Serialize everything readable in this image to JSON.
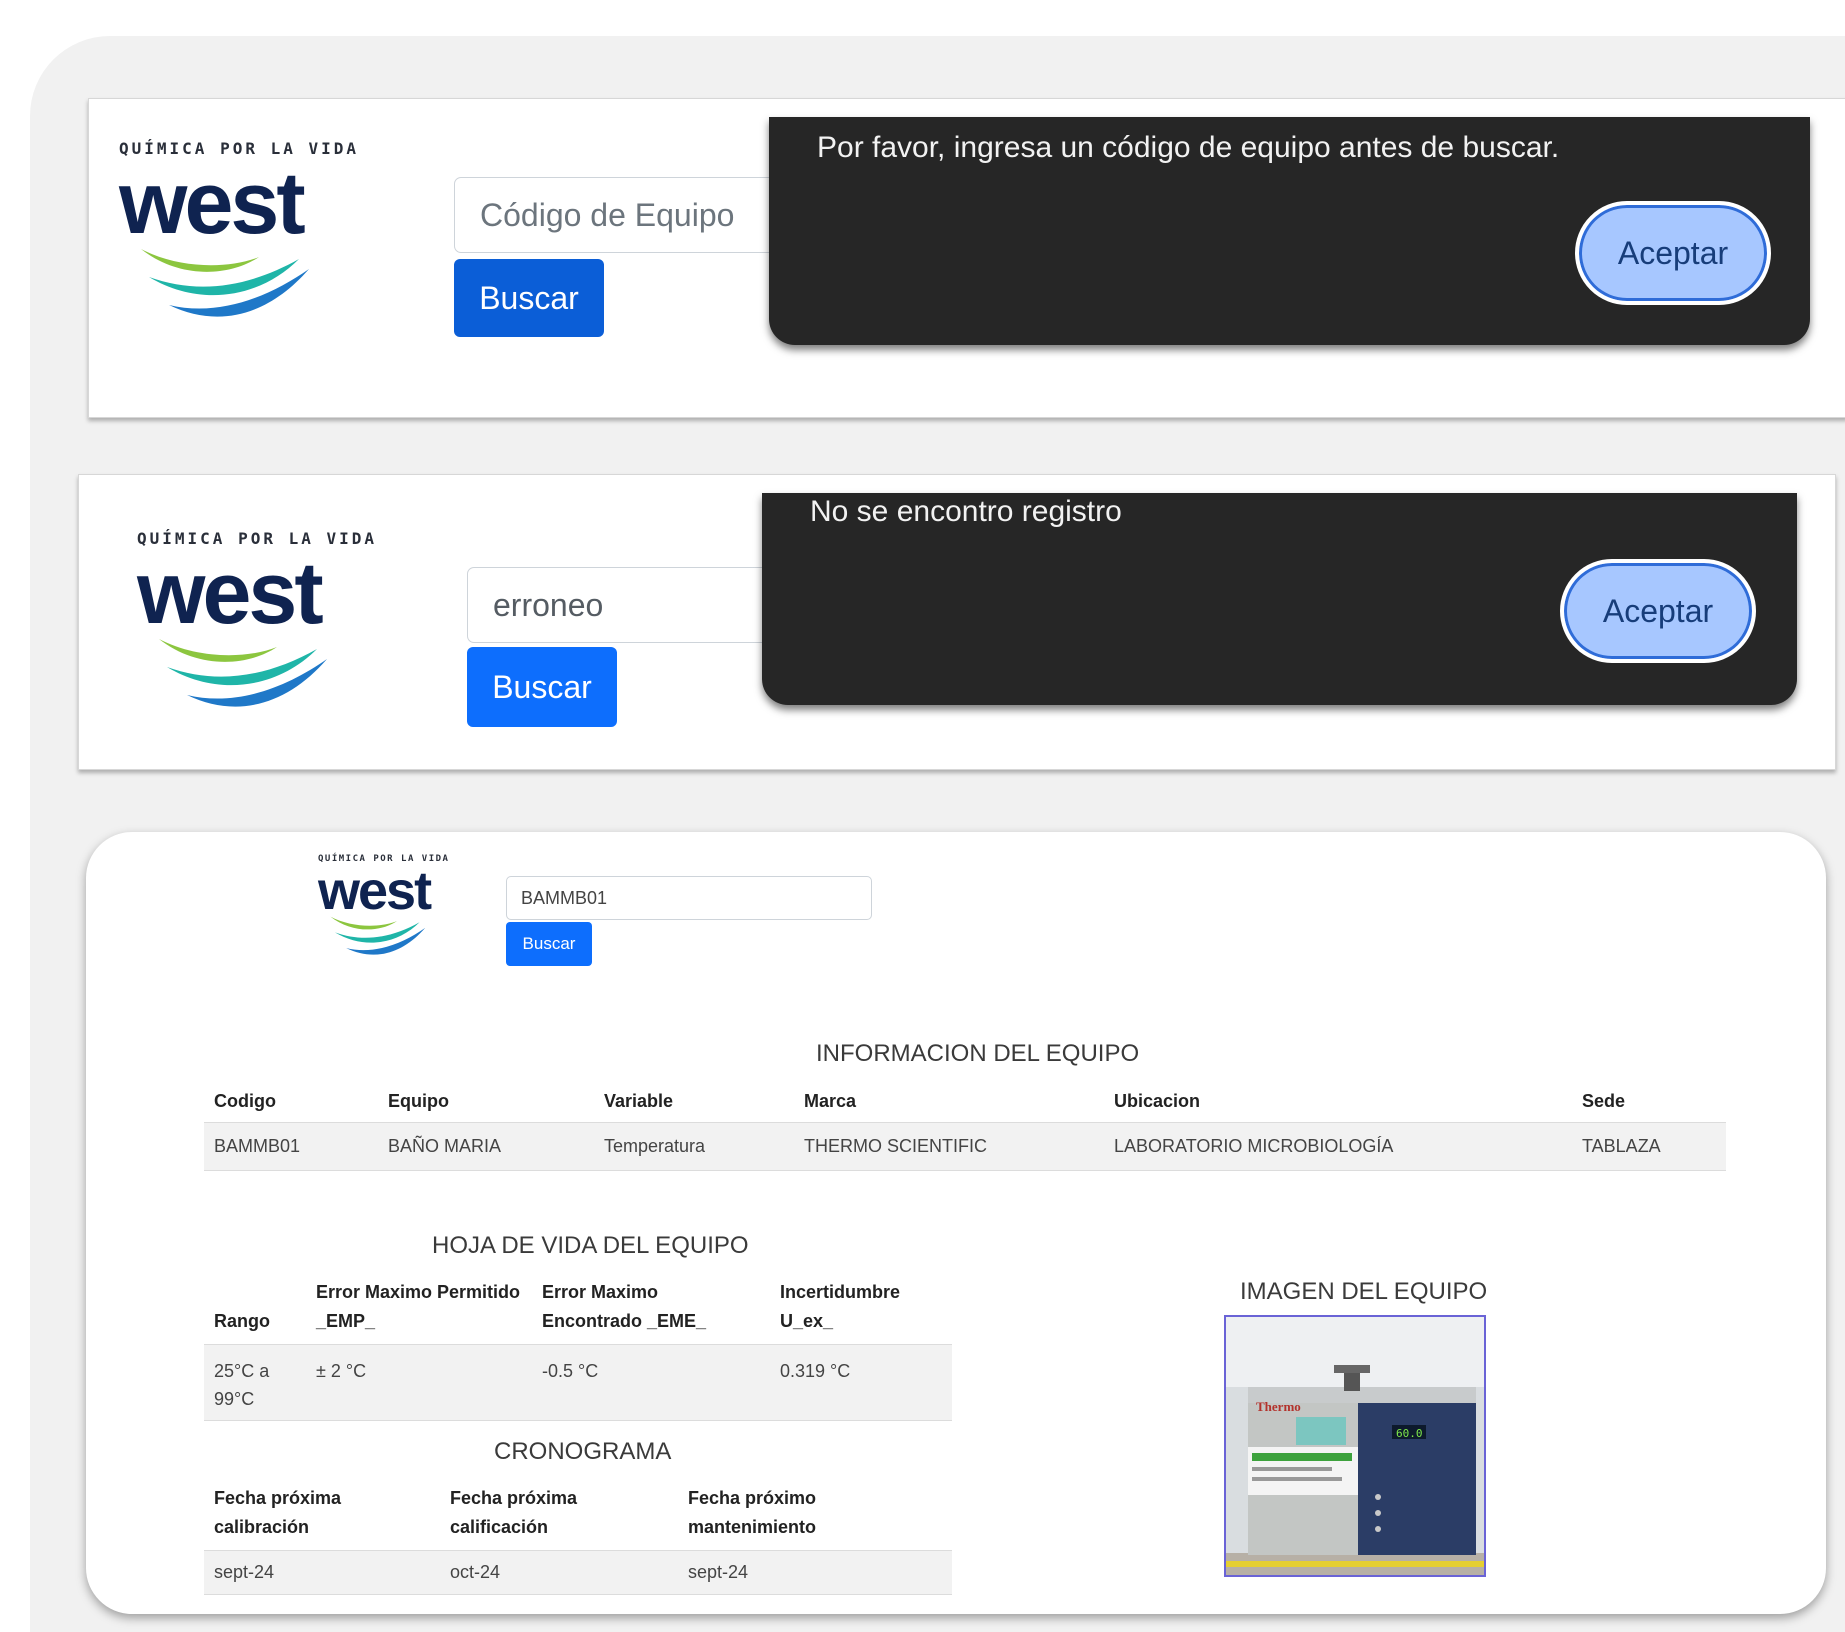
{
  "logo": {
    "tagline": "QUÍMICA POR LA VIDA",
    "wordmark": "west"
  },
  "panel1": {
    "search": {
      "placeholder": "Código de Equipo",
      "button": "Buscar"
    },
    "dialog": {
      "message": "Por favor, ingresa un código de equipo antes de buscar.",
      "button": "Aceptar"
    }
  },
  "panel2": {
    "search": {
      "value": "erroneo",
      "button": "Buscar"
    },
    "dialog": {
      "message": "No se encontro registro",
      "button": "Aceptar"
    }
  },
  "panel3": {
    "search": {
      "value": "BAMMB01",
      "button": "Buscar"
    },
    "info": {
      "title": "INFORMACION DEL EQUIPO",
      "headers": [
        "Codigo",
        "Equipo",
        "Variable",
        "Marca",
        "Ubicacion",
        "Sede"
      ],
      "row": [
        "BAMMB01",
        "BAÑO MARIA",
        "Temperatura",
        "THERMO SCIENTIFIC",
        "LABORATORIO MICROBIOLOGÍA",
        "TABLAZA"
      ]
    },
    "hoja": {
      "title": "HOJA DE VIDA DEL EQUIPO",
      "headers": [
        "Rango",
        "Error Maximo Permitido _EMP_",
        "Error Maximo Encontrado _EME_",
        "Incertidumbre U_ex_"
      ],
      "row": [
        "25°C a 99°C",
        "± 2 °C",
        "-0.5 °C",
        "0.319 °C"
      ]
    },
    "cronograma": {
      "title": "CRONOGRAMA",
      "headers": [
        "Fecha próxima calibración",
        "Fecha próxima calificación",
        "Fecha próximo mantenimiento"
      ],
      "row": [
        "sept-24",
        "oct-24",
        "sept-24"
      ]
    },
    "image": {
      "title": "IMAGEN DEL EQUIPO",
      "brand": "Thermo",
      "display": "60.0"
    }
  },
  "colors": {
    "primary": "#0d6efd",
    "dialog_bg": "#262626",
    "ok_button": "#a7c7ff",
    "logo_text": "#0f2350",
    "wave_green": "#8cc63f",
    "wave_teal": "#1fb5a8",
    "wave_blue": "#1f78c8"
  }
}
